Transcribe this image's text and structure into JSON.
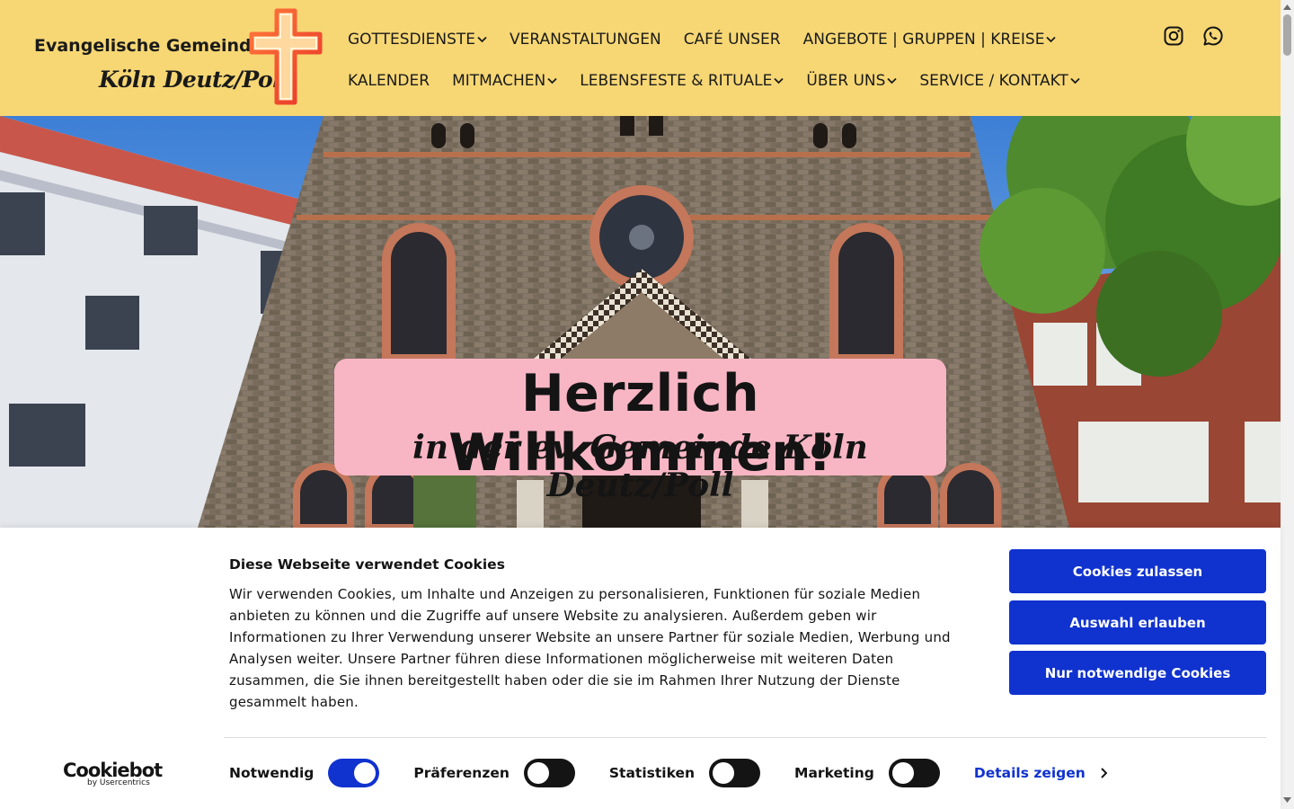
{
  "header": {
    "logo_line1": "Evangelische Gemeinde",
    "logo_line2": "Köln Deutz/Poll",
    "nav_row1": [
      {
        "label": "GOTTESDIENSTE",
        "has_dropdown": true
      },
      {
        "label": "VERANSTALTUNGEN",
        "has_dropdown": false
      },
      {
        "label": "CAFÉ UNSER",
        "has_dropdown": false
      },
      {
        "label": "ANGEBOTE | GRUPPEN | KREISE",
        "has_dropdown": true
      }
    ],
    "nav_row2": [
      {
        "label": "KALENDER",
        "has_dropdown": false
      },
      {
        "label": "MITMACHEN",
        "has_dropdown": true
      },
      {
        "label": "LEBENSFESTE & RITUALE",
        "has_dropdown": true
      },
      {
        "label": "ÜBER UNS",
        "has_dropdown": true
      },
      {
        "label": "SERVICE / KONTAKT",
        "has_dropdown": true
      }
    ],
    "social_icons": [
      "instagram-icon",
      "whatsapp-icon"
    ],
    "background_color": "#f7d774"
  },
  "hero": {
    "title": "Herzlich Willkommen!",
    "subtitle": "in der ev. Gemeinde Köln Deutz/Poll",
    "box_color": "#f8b6c4"
  },
  "cookie_banner": {
    "title": "Diese Webseite verwendet Cookies",
    "text": "Wir verwenden Cookies, um Inhalte und Anzeigen zu personalisieren, Funktionen für soziale Medien anbieten zu können und die Zugriffe auf unsere Website zu analysieren. Außerdem geben wir Informationen zu Ihrer Verwendung unserer Website an unsere Partner für soziale Medien, Werbung und Analysen weiter. Unsere Partner führen diese Informationen möglicherweise mit weiteren Daten zusammen, die Sie ihnen bereitgestellt haben oder die sie im Rahmen Ihrer Nutzung der Dienste gesammelt haben.",
    "buttons": {
      "allow_all": "Cookies zulassen",
      "allow_selection": "Auswahl erlauben",
      "necessary_only": "Nur notwendige Cookies"
    },
    "consents": [
      {
        "label": "Notwendig",
        "enabled": true
      },
      {
        "label": "Präferenzen",
        "enabled": false
      },
      {
        "label": "Statistiken",
        "enabled": false
      },
      {
        "label": "Marketing",
        "enabled": false
      }
    ],
    "details_link": "Details zeigen",
    "brand": "Cookiebot",
    "brand_by": "by Usercentrics",
    "accent_color": "#1032cf"
  }
}
